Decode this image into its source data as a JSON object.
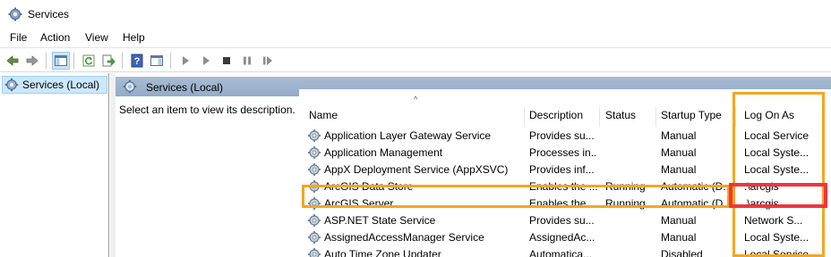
{
  "window": {
    "title": "Services",
    "icon": "gear-icon"
  },
  "menu": [
    "File",
    "Action",
    "View",
    "Help"
  ],
  "toolbar": {
    "buttons": [
      "back-arrow-icon",
      "forward-arrow-icon",
      "show-hide-console-tree-icon",
      "refresh-icon",
      "export-list-icon",
      "help-icon",
      "properties-pane-icon",
      "start-service-icon",
      "start-service-alt-icon",
      "stop-service-icon",
      "pause-service-icon",
      "restart-service-icon"
    ]
  },
  "tree": {
    "selected_item": "Services (Local)"
  },
  "pane": {
    "title": "Services (Local)",
    "description_prompt": "Select an item to view its description."
  },
  "table": {
    "columns": [
      "Name",
      "Description",
      "Status",
      "Startup Type",
      "Log On As"
    ],
    "sorted_column": "Name",
    "rows": [
      {
        "name": "Application Layer Gateway Service",
        "description": "Provides su...",
        "status": "",
        "startup": "Manual",
        "logon": "Local Service"
      },
      {
        "name": "Application Management",
        "description": "Processes in...",
        "status": "",
        "startup": "Manual",
        "logon": "Local Syste..."
      },
      {
        "name": "AppX Deployment Service (AppXSVC)",
        "description": "Provides inf...",
        "status": "",
        "startup": "Manual",
        "logon": "Local Syste..."
      },
      {
        "name": "ArcGIS Data Store",
        "description": "Enables the ...",
        "status": "Running",
        "startup": "Automatic (D...",
        "logon": ".\\arcgis"
      },
      {
        "name": "ArcGIS Server",
        "description": "Enables the ...",
        "status": "Running",
        "startup": "Automatic (D...",
        "logon": ".\\arcgis"
      },
      {
        "name": "ASP.NET State Service",
        "description": "Provides su...",
        "status": "",
        "startup": "Manual",
        "logon": "Network S..."
      },
      {
        "name": "AssignedAccessManager Service",
        "description": "AssignedAc...",
        "status": "",
        "startup": "Manual",
        "logon": "Local Syste..."
      },
      {
        "name": "Auto Time Zone Updater",
        "description": "Automatica...",
        "status": "",
        "startup": "Disabled",
        "logon": "Local Service"
      }
    ]
  },
  "annotations": {
    "highlight_color_orange": "#f5a623",
    "highlight_color_red": "#f2343d",
    "highlighted_row": "ArcGIS Server",
    "highlighted_column": "Log On As",
    "highlighted_cell": ".\\arcgis"
  }
}
